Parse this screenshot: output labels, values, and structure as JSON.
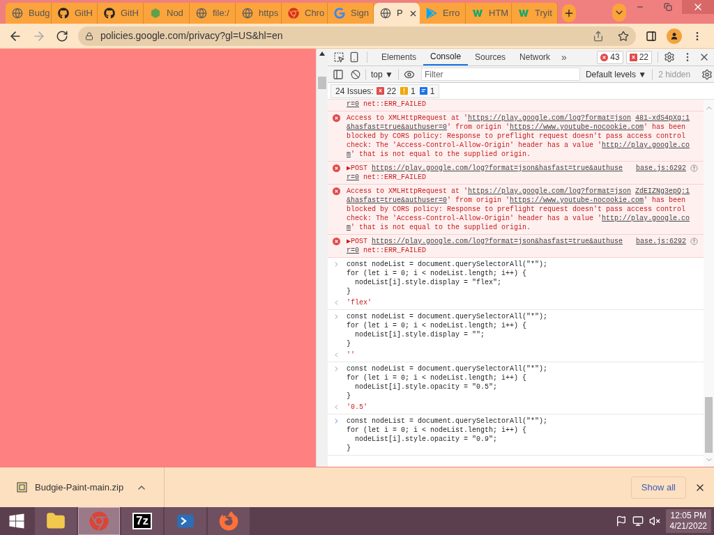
{
  "tabs": [
    {
      "kind": "globe",
      "title": "Budg",
      "selected": false
    },
    {
      "kind": "github",
      "title": "GitH",
      "selected": false
    },
    {
      "kind": "github",
      "title": "GitH",
      "selected": false
    },
    {
      "kind": "node",
      "title": "Nod",
      "selected": false
    },
    {
      "kind": "globe",
      "title": "file:/",
      "selected": false
    },
    {
      "kind": "globe",
      "title": "https",
      "selected": false
    },
    {
      "kind": "chrome",
      "title": "Chro",
      "selected": false
    },
    {
      "kind": "google",
      "title": "Sign",
      "selected": false
    },
    {
      "kind": "globe",
      "title": "P",
      "selected": true
    },
    {
      "kind": "play",
      "title": "Erro",
      "selected": false
    },
    {
      "kind": "w3",
      "title": "HTM",
      "selected": false
    },
    {
      "kind": "w3",
      "title": "Tryit",
      "selected": false
    }
  ],
  "address_bar": {
    "url": "policies.google.com/privacy?gl=US&hl=en"
  },
  "devtools": {
    "tabs": [
      {
        "label": "Elements",
        "selected": false
      },
      {
        "label": "Console",
        "selected": true
      },
      {
        "label": "Sources",
        "selected": false
      },
      {
        "label": "Network",
        "selected": false
      }
    ],
    "more": "»",
    "error_count": "43",
    "issue_count": "22",
    "context": "top ▼",
    "filter": {
      "placeholder": "Filter"
    },
    "levels": "Default levels ▼",
    "hidden": "2 hidden",
    "issues": {
      "label": "24 Issues:",
      "errors": "22",
      "warnings": "1",
      "info": "1"
    },
    "messages": [
      {
        "kind": "fragment",
        "lines": [
          [
            {
              "t": "r=0",
              "link": true
            },
            {
              "t": " net::ERR_FAILED"
            }
          ]
        ]
      },
      {
        "kind": "error",
        "source": "481-xdS4pXg:1",
        "lines": [
          [
            {
              "t": "Access to XMLHttpRequest at '"
            },
            {
              "t": "https://play.google.com/log?format=json",
              "link": true
            }
          ],
          [
            {
              "t": "&hasfast=true&authuser=0",
              "link": true
            },
            {
              "t": "' from origin '"
            },
            {
              "t": "https://www.youtube-nocookie.com",
              "link": true
            },
            {
              "t": "' has been"
            }
          ],
          [
            {
              "t": "blocked by CORS policy: Response to preflight request doesn't pass access control"
            }
          ],
          [
            {
              "t": "check: The 'Access-Control-Allow-Origin' header has a value '"
            },
            {
              "t": "http://play.google.co",
              "link": true
            }
          ],
          [
            {
              "t": "m",
              "link": true
            },
            {
              "t": "' that is not equal to the supplied origin."
            }
          ]
        ]
      },
      {
        "kind": "post",
        "source": "base.js:6292",
        "lines": [
          [
            {
              "t": "▶POST "
            },
            {
              "t": "https://play.google.com/log?format=json&hasfast=true&authuse",
              "link": true
            }
          ],
          [
            {
              "t": "r=0",
              "link": true
            },
            {
              "t": " net::ERR_FAILED"
            }
          ]
        ]
      },
      {
        "kind": "error",
        "source": "ZdEIZNg3epQ:1",
        "lines": [
          [
            {
              "t": "Access to XMLHttpRequest at '"
            },
            {
              "t": "https://play.google.com/log?format=json",
              "link": true
            }
          ],
          [
            {
              "t": "&hasfast=true&authuser=0",
              "link": true
            },
            {
              "t": "' from origin '"
            },
            {
              "t": "https://www.youtube-nocookie.com",
              "link": true
            },
            {
              "t": "' has been"
            }
          ],
          [
            {
              "t": "blocked by CORS policy: Response to preflight request doesn't pass access control"
            }
          ],
          [
            {
              "t": "check: The 'Access-Control-Allow-Origin' header has a value '"
            },
            {
              "t": "http://play.google.co",
              "link": true
            }
          ],
          [
            {
              "t": "m",
              "link": true
            },
            {
              "t": "' that is not equal to the supplied origin."
            }
          ]
        ]
      },
      {
        "kind": "post",
        "source": "base.js:6292",
        "lines": [
          [
            {
              "t": "▶POST "
            },
            {
              "t": "https://play.google.com/log?format=json&hasfast=true&authuse",
              "link": true
            }
          ],
          [
            {
              "t": "r=0",
              "link": true
            },
            {
              "t": " net::ERR_FAILED"
            }
          ]
        ]
      },
      {
        "kind": "input",
        "code": [
          "const nodeList = document.querySelectorAll(\"*\");",
          "for (let i = 0; i < nodeList.length; i++) {",
          "  nodeList[i].style.display = \"flex\";",
          "}"
        ],
        "result": "'flex'"
      },
      {
        "kind": "input",
        "code": [
          "const nodeList = document.querySelectorAll(\"*\");",
          "for (let i = 0; i < nodeList.length; i++) {",
          "  nodeList[i].style.display = \"\";",
          "}"
        ],
        "result": "''"
      },
      {
        "kind": "input",
        "code": [
          "const nodeList = document.querySelectorAll(\"*\");",
          "for (let i = 0; i < nodeList.length; i++) {",
          "  nodeList[i].style.opacity = \"0.5\";",
          "}"
        ],
        "result": "'0.5'"
      },
      {
        "kind": "prompt",
        "code": [
          "const nodeList = document.querySelectorAll(\"*\");",
          "for (let i = 0; i < nodeList.length; i++) {",
          "  nodeList[i].style.opacity = \"0.9\";",
          "}"
        ]
      }
    ]
  },
  "download": {
    "file": "Budgie-Paint-main.zip",
    "show_all": "Show all"
  },
  "taskbar": {
    "apps": [
      {
        "kind": "explorer",
        "selected": false
      },
      {
        "kind": "chrome",
        "selected": true
      },
      {
        "kind": "archiver",
        "label": "7z",
        "selected": false
      },
      {
        "kind": "powershell",
        "selected": false
      },
      {
        "kind": "firefox",
        "selected": false
      }
    ],
    "time": "12:05 PM",
    "date": "4/21/2022"
  }
}
